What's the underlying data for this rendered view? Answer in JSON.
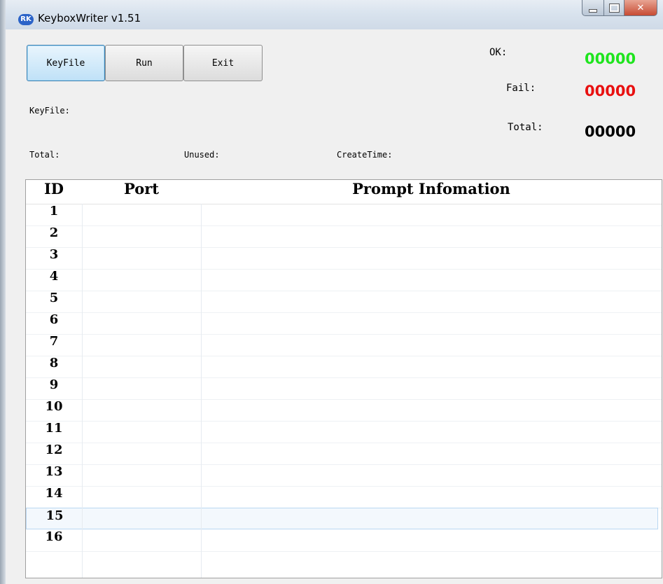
{
  "window": {
    "title": "KeyboxWriter v1.51",
    "icon_text": "RK",
    "controls": {
      "minimize_icon": "minimize-icon",
      "maximize_icon": "maximize-icon",
      "close_icon": "close-icon"
    }
  },
  "toolbar": {
    "keyfile_label": "KeyFile",
    "run_label": "Run",
    "exit_label": "Exit"
  },
  "info": {
    "keyfile_label": "KeyFile:",
    "total_label": "Total:",
    "unused_label": "Unused:",
    "createtime_label": "CreateTime:"
  },
  "stats": {
    "ok_label": "OK:",
    "ok_value": "00000",
    "fail_label": "Fail:",
    "fail_value": "00000",
    "total_label": "Total:",
    "total_value": "00000",
    "ok_color": "#1ee41e",
    "fail_color": "#e81010",
    "total_color": "#000000"
  },
  "grid": {
    "columns": [
      "ID",
      "Port",
      "Prompt Infomation"
    ],
    "rows": [
      {
        "id": "1"
      },
      {
        "id": "2"
      },
      {
        "id": "3"
      },
      {
        "id": "4"
      },
      {
        "id": "5"
      },
      {
        "id": "6"
      },
      {
        "id": "7"
      },
      {
        "id": "8"
      },
      {
        "id": "9"
      },
      {
        "id": "10"
      },
      {
        "id": "11"
      },
      {
        "id": "12"
      },
      {
        "id": "13"
      },
      {
        "id": "14"
      },
      {
        "id": "15"
      },
      {
        "id": "16"
      }
    ],
    "selected_row": "15"
  }
}
